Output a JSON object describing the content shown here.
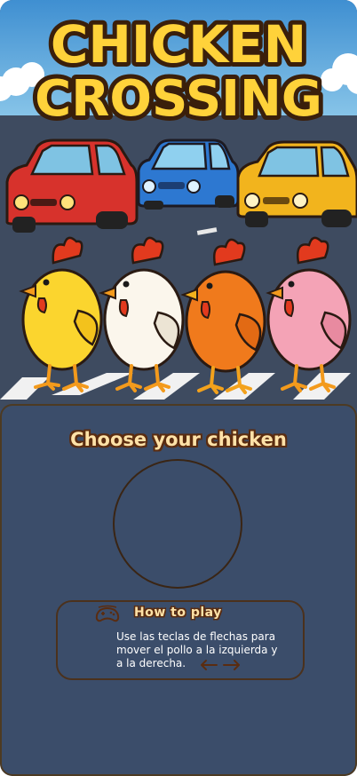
{
  "hero": {
    "title_line1": "CHICKEN",
    "title_line2": "CROSSING",
    "cars": [
      "red-car",
      "blue-car",
      "yellow-car"
    ],
    "chickens": [
      "yellow-chicken",
      "white-chicken",
      "orange-chicken",
      "pink-chicken"
    ]
  },
  "panel": {
    "choose_title": "Choose your chicken"
  },
  "howto": {
    "title": "How to play",
    "text": "Use las teclas de flechas para mover el pollo a la izquierda y a la derecha.",
    "icons": [
      "gamepad-icon",
      "arrow-left-icon",
      "arrow-right-icon"
    ]
  },
  "colors": {
    "panel_bg": "#3b4d6a",
    "panel_border": "#4d3a22",
    "title_fill": "#ffd23a",
    "title_outline": "#3a1f0b",
    "label_fill": "#ffe2a8"
  }
}
